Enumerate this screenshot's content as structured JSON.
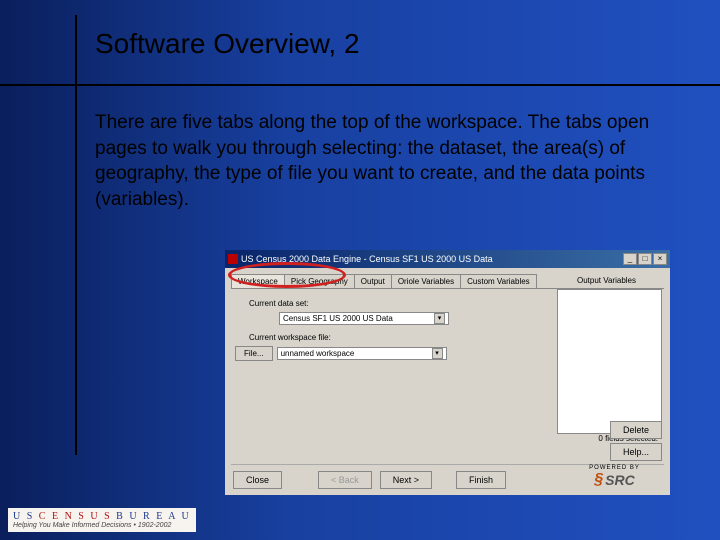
{
  "slide": {
    "title": "Software Overview, 2",
    "body": "There are five tabs along the top of the workspace. The tabs open pages to walk you through selecting: the dataset, the area(s) of geography, the type of file you want to create, and the data points (variables)."
  },
  "window": {
    "title": "US Census 2000 Data Engine - Census SF1 US 2000 US Data",
    "min": "_",
    "max": "□",
    "close": "×",
    "tabs": [
      {
        "label": "Workspace",
        "active": true
      },
      {
        "label": "Pick Geography"
      },
      {
        "label": "Output"
      },
      {
        "label": "Oriole Variables"
      },
      {
        "label": "Custom Variables"
      }
    ],
    "output_label": "Output Variables",
    "dataset_label": "Current data set:",
    "dataset_value": "Census SF1 US 2000 US Data",
    "workspace_label": "Current workspace file:",
    "workspace_value": "unnamed workspace",
    "file_btn": "File...",
    "status": "0 fields selected.",
    "buttons": {
      "close": "Close",
      "back": "< Back",
      "next": "Next >",
      "finish": "Finish",
      "delete": "Delete",
      "help": "Help..."
    },
    "powered": "POWERED BY",
    "src": "SRC"
  },
  "footer": {
    "line1_us": "U S ",
    "line1_census": "C E N S U S ",
    "line1_bureau": "B U R E A U",
    "line2": "Helping You Make Informed Decisions • 1902-2002"
  }
}
